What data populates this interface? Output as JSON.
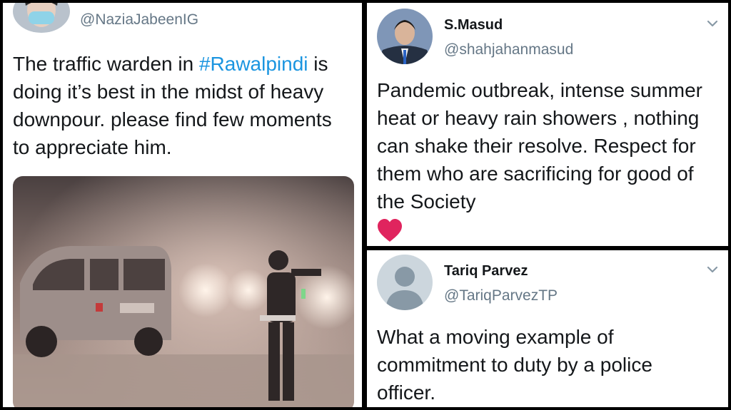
{
  "tweet_left": {
    "handle": "@NaziaJabeenIG",
    "text_before": "The traffic warden in ",
    "hashtag": "#Rawalpindi",
    "text_after": " is doing it’s best in the midst of heavy downpour. please find few moments to appreciate him.",
    "image_alt": "traffic warden in rain"
  },
  "tweet_top_right": {
    "name": "S.Masud",
    "handle": "@shahjahanmasud",
    "text": "Pandemic outbreak, intense summer heat or heavy rain showers , nothing can shake their resolve. Respect for them who are sacrificing for good of the Society",
    "emoji": "heart-icon"
  },
  "tweet_bottom_right": {
    "name": "Tariq Parvez",
    "handle": "@TariqParvezTP",
    "text": "What a moving example of commitment to duty by a police officer."
  },
  "colors": {
    "link": "#1b95e0",
    "secondary_text": "#657786",
    "heart": "#e0245e"
  }
}
